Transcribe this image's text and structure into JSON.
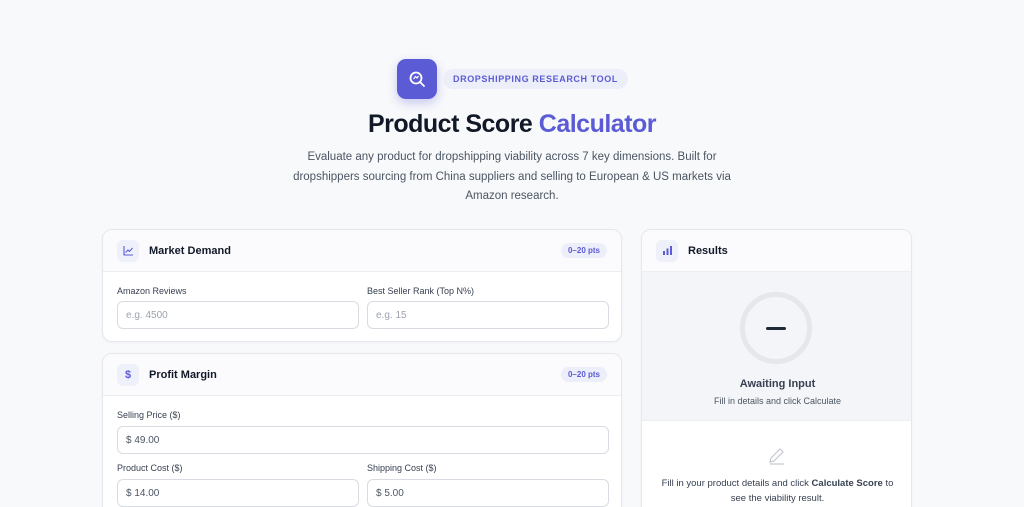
{
  "header": {
    "tag": "DROPSHIPPING RESEARCH TOOL",
    "title_main": "Product Score ",
    "title_accent": "Calculator",
    "subtitle": "Evaluate any product for dropshipping viability across 7 key dimensions. Built for dropshippers sourcing from China suppliers and selling to European & US markets via Amazon research."
  },
  "market_demand": {
    "title": "Market Demand",
    "points": "0–20 pts",
    "fields": [
      {
        "label": "Amazon Reviews",
        "placeholder": "e.g. 4500"
      },
      {
        "label": "Best Seller Rank (Top N%)",
        "placeholder": "e.g. 15"
      }
    ]
  },
  "profit_margin": {
    "title": "Profit Margin",
    "points": "0–20 pts",
    "fields": [
      {
        "label": "Selling Price ($)",
        "value": "$ 49.00"
      },
      {
        "label": "Product Cost ($)",
        "value": "$ 14.00"
      },
      {
        "label": "Shipping Cost ($)",
        "value": "$ 5.00"
      }
    ]
  },
  "results": {
    "title": "Results",
    "score_symbol": "—",
    "status": "Awaiting Input",
    "status_hint": "Fill in details and click Calculate",
    "info_prefix": "Fill in your product details and click ",
    "info_bold": "Calculate Score",
    "info_suffix": " to see the viability result."
  },
  "colors": {
    "accent": "#5b5bd6",
    "background": "#f8f9fb"
  }
}
